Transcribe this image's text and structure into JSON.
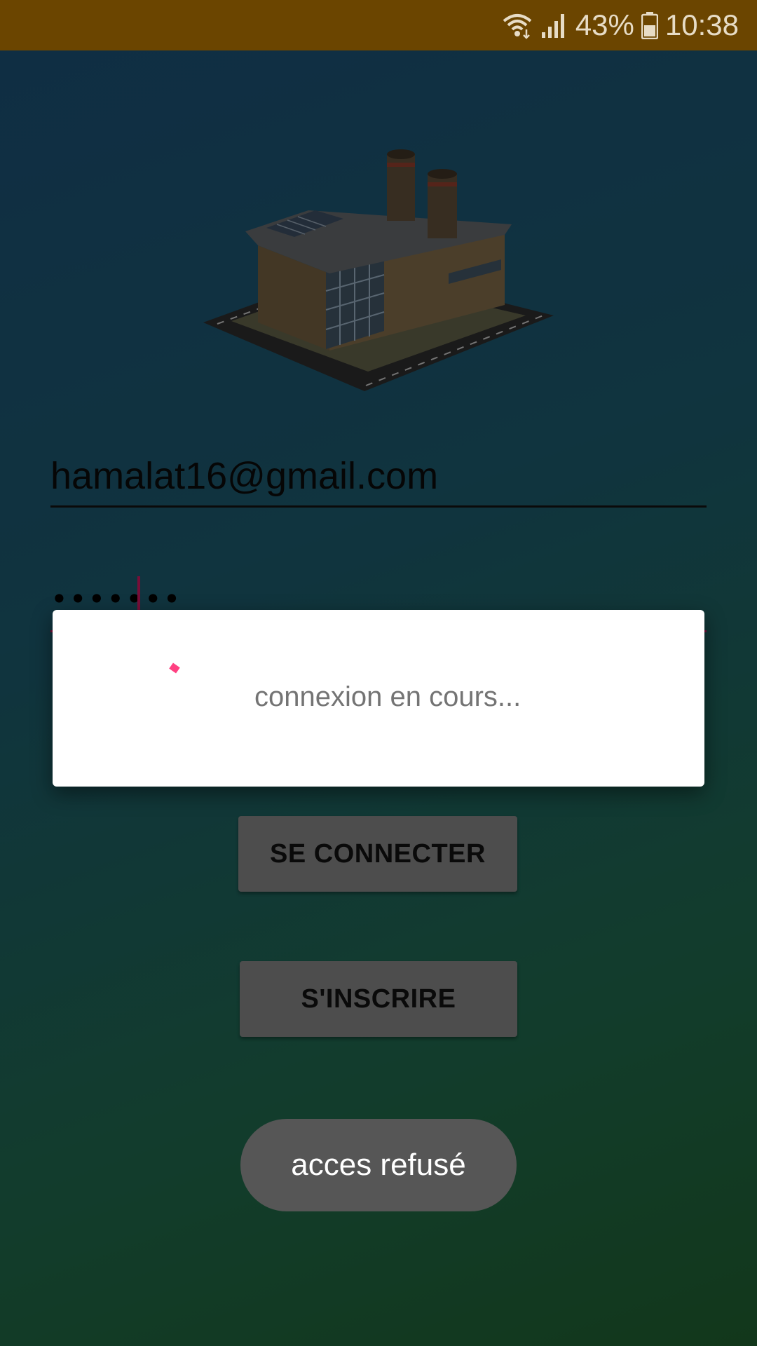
{
  "status_bar": {
    "battery_percent": "43%",
    "time": "10:38",
    "background_color": "#6b4500",
    "icons": [
      "wifi-icon",
      "signal-icon",
      "battery-icon"
    ]
  },
  "login": {
    "logo_icon": "factory-icon",
    "email_value": "hamalat16@gmail.com",
    "password_value": "•••••••",
    "login_button_label": "SE CONNECTER",
    "signup_button_label": "S'INSCRIRE"
  },
  "dialog": {
    "message": "connexion en cours...",
    "spinner_color": "#ff4081"
  },
  "toast": {
    "message": "acces refusé"
  }
}
